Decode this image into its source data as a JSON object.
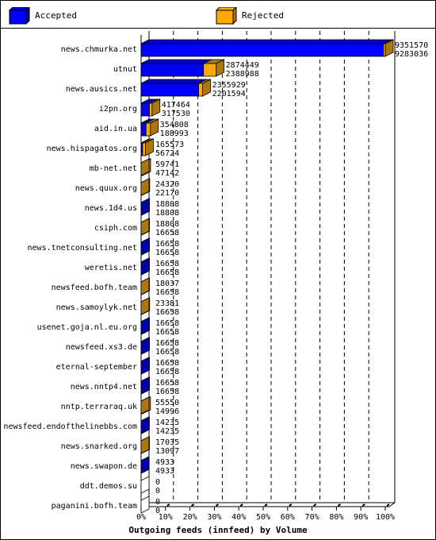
{
  "legend": [
    {
      "label": "Accepted",
      "color": "#0000ff",
      "side_color": "#00009a"
    },
    {
      "label": "Rejected",
      "color": "#ffaa00",
      "side_color": "#aa7711"
    }
  ],
  "chart_data": {
    "type": "bar",
    "orientation": "horizontal",
    "stacked": true,
    "style": "3d",
    "title": "",
    "xlabel": "Outgoing feeds (innfeed) by Volume",
    "ylabel": "",
    "xlim_percent": [
      0,
      100
    ],
    "x_ticks": [
      "0%",
      "10%",
      "20%",
      "30%",
      "40%",
      "50%",
      "60%",
      "70%",
      "80%",
      "90%",
      "100%"
    ],
    "grid": "vertical dashed",
    "legend_position": "top",
    "categories": [
      "news.chmurka.net",
      "utnut",
      "news.ausics.net",
      "i2pn.org",
      "aid.in.ua",
      "news.hispagatos.org",
      "mb-net.net",
      "news.quux.org",
      "news.1d4.us",
      "csiph.com",
      "news.tnetconsulting.net",
      "weretis.net",
      "newsfeed.bofh.team",
      "news.samoylyk.net",
      "usenet.goja.nl.eu.org",
      "newsfeed.xs3.de",
      "eternal-september",
      "news.nntp4.net",
      "nntp.terraraq.uk",
      "newsfeed.endofthelinebbs.com",
      "news.snarked.org",
      "news.swapon.de",
      "ddt.demos.su",
      "paganini.bofh.team"
    ],
    "totals": [
      9351570,
      2874449,
      2355929,
      417464,
      354808,
      165573,
      59741,
      24320,
      18808,
      18808,
      16658,
      16658,
      18037,
      23381,
      16658,
      16658,
      16658,
      16658,
      55550,
      14235,
      17035,
      4933,
      0,
      0
    ],
    "series": [
      {
        "name": "Accepted",
        "values": [
          9283036,
          2388988,
          2201594,
          317530,
          188993,
          56724,
          47142,
          22170,
          18808,
          16658,
          16658,
          16658,
          16658,
          16658,
          16658,
          16658,
          16658,
          16658,
          14996,
          14235,
          13097,
          4933,
          0,
          0
        ]
      },
      {
        "name": "Rejected",
        "values": [
          68534,
          485461,
          154335,
          99934,
          165815,
          108849,
          12599,
          2150,
          0,
          2150,
          0,
          0,
          1379,
          6723,
          0,
          0,
          0,
          0,
          40554,
          0,
          3938,
          0,
          0,
          0
        ]
      }
    ],
    "labels_top": [
      "9351570",
      "2874449",
      "2355929",
      "417464",
      "354808",
      "165573",
      "59741",
      "24320",
      "18808",
      "18808",
      "16658",
      "16658",
      "18037",
      "23381",
      "16658",
      "16658",
      "16658",
      "16658",
      "55550",
      "14235",
      "17035",
      "4933",
      "0",
      "0"
    ],
    "labels_bottom": [
      "9283036",
      "2388988",
      "2201594",
      "317530",
      "188993",
      "56724",
      "47142",
      "22170",
      "18808",
      "16658",
      "16658",
      "16658",
      "16658",
      "16658",
      "16658",
      "16658",
      "16658",
      "16658",
      "14996",
      "14235",
      "13097",
      "4933",
      "0",
      "0"
    ]
  }
}
